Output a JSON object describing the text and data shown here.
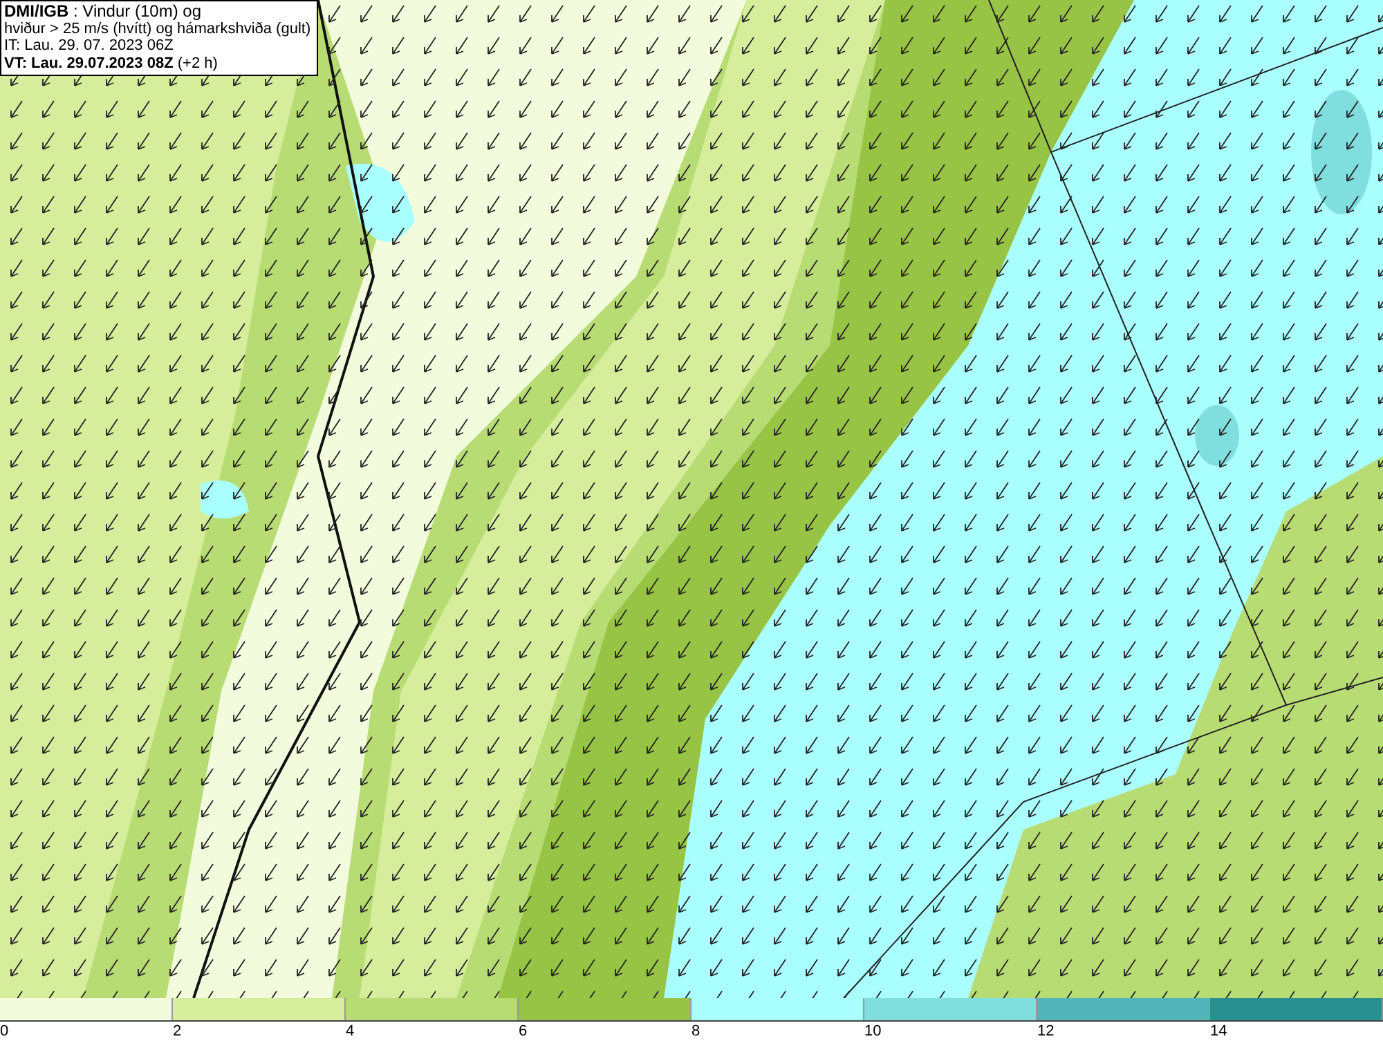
{
  "info_box": {
    "lines": [
      "**DMI/IGB** : Vindur (10m) og",
      "hviður > 25 m/s (hvítt) og hámarkshviða (gult)",
      "IT: Lau. 29. 07. 2023 06Z",
      "**VT: Lau. 29.07.2023 08Z** (+2 h)"
    ]
  },
  "legend": {
    "bins": [
      {
        "label": "0",
        "color": "#f2fbdc"
      },
      {
        "label": "2",
        "color": "#d6ee9c"
      },
      {
        "label": "4",
        "color": "#b8dc74"
      },
      {
        "label": "6",
        "color": "#98c446"
      },
      {
        "label": "8",
        "color": "#aaffff"
      },
      {
        "label": "10",
        "color": "#80dede"
      },
      {
        "label": "12",
        "color": "#50b4b8"
      },
      {
        "label": "14",
        "color": "#289090"
      }
    ]
  }
}
